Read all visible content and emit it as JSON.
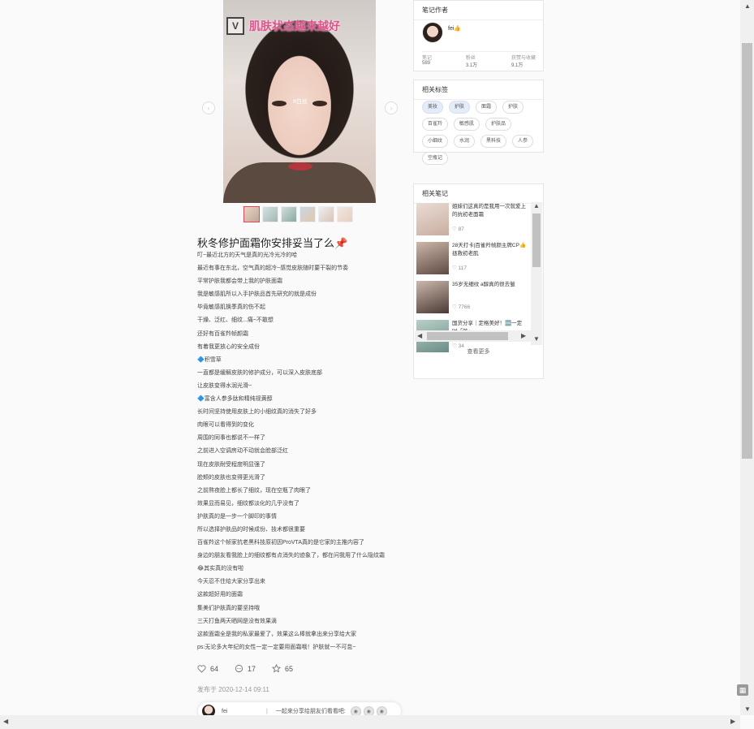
{
  "post": {
    "image_caption": "肌肤状态越来越好",
    "image_logo": "V",
    "image_watermark": "#白丝",
    "title": "秋冬修护面霜你安排妥当了么📌",
    "lines": [
      "叮~最近北方的天气是真的光冷光冷的哈",
      "最近有事在东北，空气真的超冷~感觉皮肤随时要干裂的节奏",
      "平常护肤我都会带上我的护肤面霜",
      "我是敏感肌所以入手护肤品首先研究的就是成份",
      "毕竟敏感肌换季真的伤不起",
      "干燥、泛红、细纹...痛~不敢想",
      "还好有百雀羚帧颜霜",
      "有着我更放心的安全成份",
      "🔷积雪草",
      "一直都是缓解皮肤的修护成分，可以深入皮肤底部",
      "让皮肤变得水润光滑~",
      "🔷富含人参多肽和精纯视黄醇",
      "长时间坚持使用皮肤上的小细纹真的消失了好多",
      "肉眼可以看得到的变化",
      "周围的同事也都说不一样了",
      "之前进入空调房动不动就会脸部泛红",
      "现在皮肤耐受程度明显强了",
      "脸颊的皮肤也变得更光滑了",
      "之前熬夜脸上都长了细纹，现在空瓶了肉眼了",
      "效果显而易见，细纹都淡化的几乎没有了",
      "护肤真的是一步一个脚印的事情",
      "所以选择护肤品的时候成份、技术都很重要",
      "百雀羚这个帧家抗老黑科技原初因ProVTA真的是它家的主推内容了",
      "身边的朋友看我脸上的细纹都有点消失的迹象了，都在问我用了什么隐纹霜",
      "😂其实真的没有啦",
      "今天忍不住给大家分享出来",
      "这款超好用的面霜",
      "集美们护肤真的要坚持哦",
      "三天打鱼两天晒网是没有效果滴",
      "这款面霜全是我的私家最爱了，效果这么棒就拿出来分享给大家",
      "ps:无论多大年纪的女性一定一定要用面霜哦！护肤就一不可怠~"
    ],
    "likes": "64",
    "comments": "17",
    "favorites": "65",
    "publish_time": "发布于 2020-12-14 09:11"
  },
  "share_bar": {
    "author": "fei",
    "separator": "|",
    "prompt": "一起来分享给朋友们看看吧:"
  },
  "author_card": {
    "title": "笔记作者",
    "name": "fei👍",
    "stats": [
      {
        "label": "笔记",
        "value": "589"
      },
      {
        "label": "粉丝",
        "value": "3.1万"
      },
      {
        "label": "获赞与收藏",
        "value": "9.1万"
      }
    ]
  },
  "tags_card": {
    "title": "相关标签",
    "tags": [
      "美妆",
      "护肤",
      "面霜",
      "护肤",
      "百雀羚",
      "敏感肌",
      "护肤品",
      "小细纹",
      "水润",
      "黑科技",
      "人参",
      "空瓶记"
    ],
    "highlighted": [
      0,
      1
    ]
  },
  "related_card": {
    "title": "相关笔记",
    "items": [
      {
        "text": "姐妹们这真的是我用一次就爱上的抗初老面霜",
        "likes": "87"
      },
      {
        "text": "28天打卡|百雀羚帧颜主牌CP👍拯救初老肌",
        "likes": "117"
      },
      {
        "text": "35岁无细纹 a醇真的很去皱",
        "likes": "7766"
      },
      {
        "text": "国货分享｜定格美好！🆒一定时「皱」",
        "likes": "34"
      }
    ],
    "see_more": "查看更多"
  },
  "colors": {
    "accent_pink": "#e2508a",
    "thumb_active": "#e24a57",
    "tag_highlight": "#e3ecf8"
  }
}
